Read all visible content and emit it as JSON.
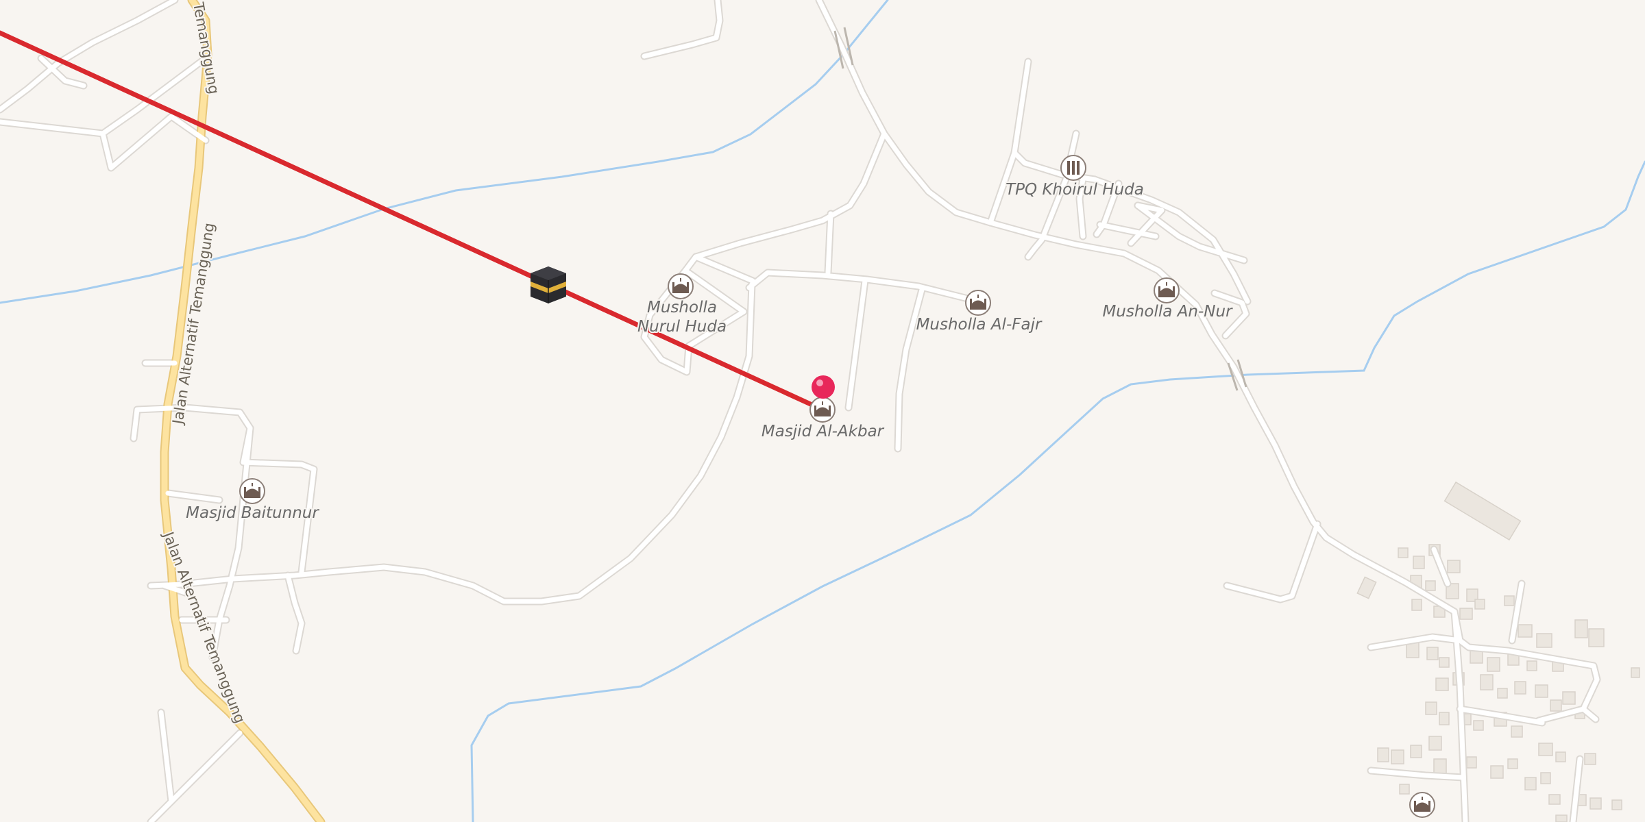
{
  "map": {
    "colors": {
      "land": "#f8f5f1",
      "water": "#a6cdef",
      "road": "#ffffff",
      "main_road": "#fde3a0",
      "qibla_line": "#d9292e",
      "pin": "#e8275a",
      "building": "#ebe6df"
    },
    "roads": {
      "main_road_name_1": "Jalan Alternatif Temanggung",
      "main_road_name_2": "Jalan Alternatif Temanggung",
      "main_road_name_3": "Temanggung"
    },
    "pois": [
      {
        "id": "musholla-nurul-huda",
        "line1": "Musholla",
        "line2": "Nurul Huda",
        "icon": "mosque-icon"
      },
      {
        "id": "musholla-al-fajr",
        "line1": "Musholla Al-Fajr",
        "icon": "mosque-icon"
      },
      {
        "id": "tpq-khoirul-huda",
        "line1": "TPQ Khoirul Huda",
        "icon": "school-icon"
      },
      {
        "id": "musholla-an-nur",
        "line1": "Musholla An-Nur",
        "icon": "mosque-icon"
      },
      {
        "id": "masjid-al-akbar",
        "line1": "Masjid Al-Akbar",
        "icon": "mosque-icon"
      },
      {
        "id": "masjid-baitunnur",
        "line1": "Masjid Baitunnur",
        "icon": "mosque-icon"
      },
      {
        "id": "mosque-bottom-right",
        "line1": "",
        "icon": "mosque-icon"
      }
    ],
    "markers": {
      "qibla_direction_icon": "kaaba-icon",
      "location_pin_icon": "map-pin-icon"
    }
  }
}
